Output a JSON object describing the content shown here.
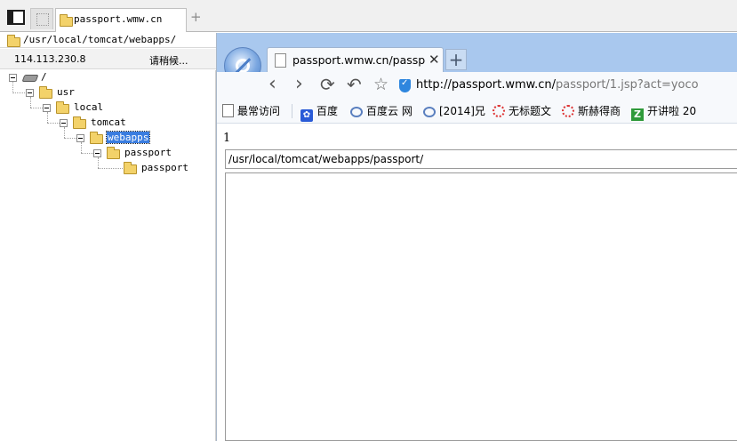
{
  "outer": {
    "tab_label": "passport.wmw.cn",
    "path": "/usr/local/tomcat/webapps/",
    "ip": "114.113.230.8",
    "loading": "请稍候...",
    "add_tab": "+"
  },
  "tree": {
    "root": "/",
    "usr": "usr",
    "local": "local",
    "tomcat": "tomcat",
    "webapps": "webapps",
    "passport_dir": "passport",
    "passport_sub": "passport"
  },
  "browser": {
    "tab_title": "passport.wmw.cn/passport",
    "tab_close": "✕",
    "add_tab": "+",
    "nav": {
      "back": "‹",
      "forward": "›",
      "reload": "⟳",
      "undo": "↶",
      "star": "☆"
    },
    "url_host": "http://passport.wmw.cn/",
    "url_path": "passport/1.jsp?act=yoco",
    "bookmarks": [
      "最常访问",
      "百度",
      "百度云 网",
      "[2014]兄",
      "无标题文",
      "斯赫得商",
      "开讲啦 20"
    ]
  },
  "content": {
    "line_number": "1",
    "path_value": "/usr/local/tomcat/webapps/passport/"
  }
}
